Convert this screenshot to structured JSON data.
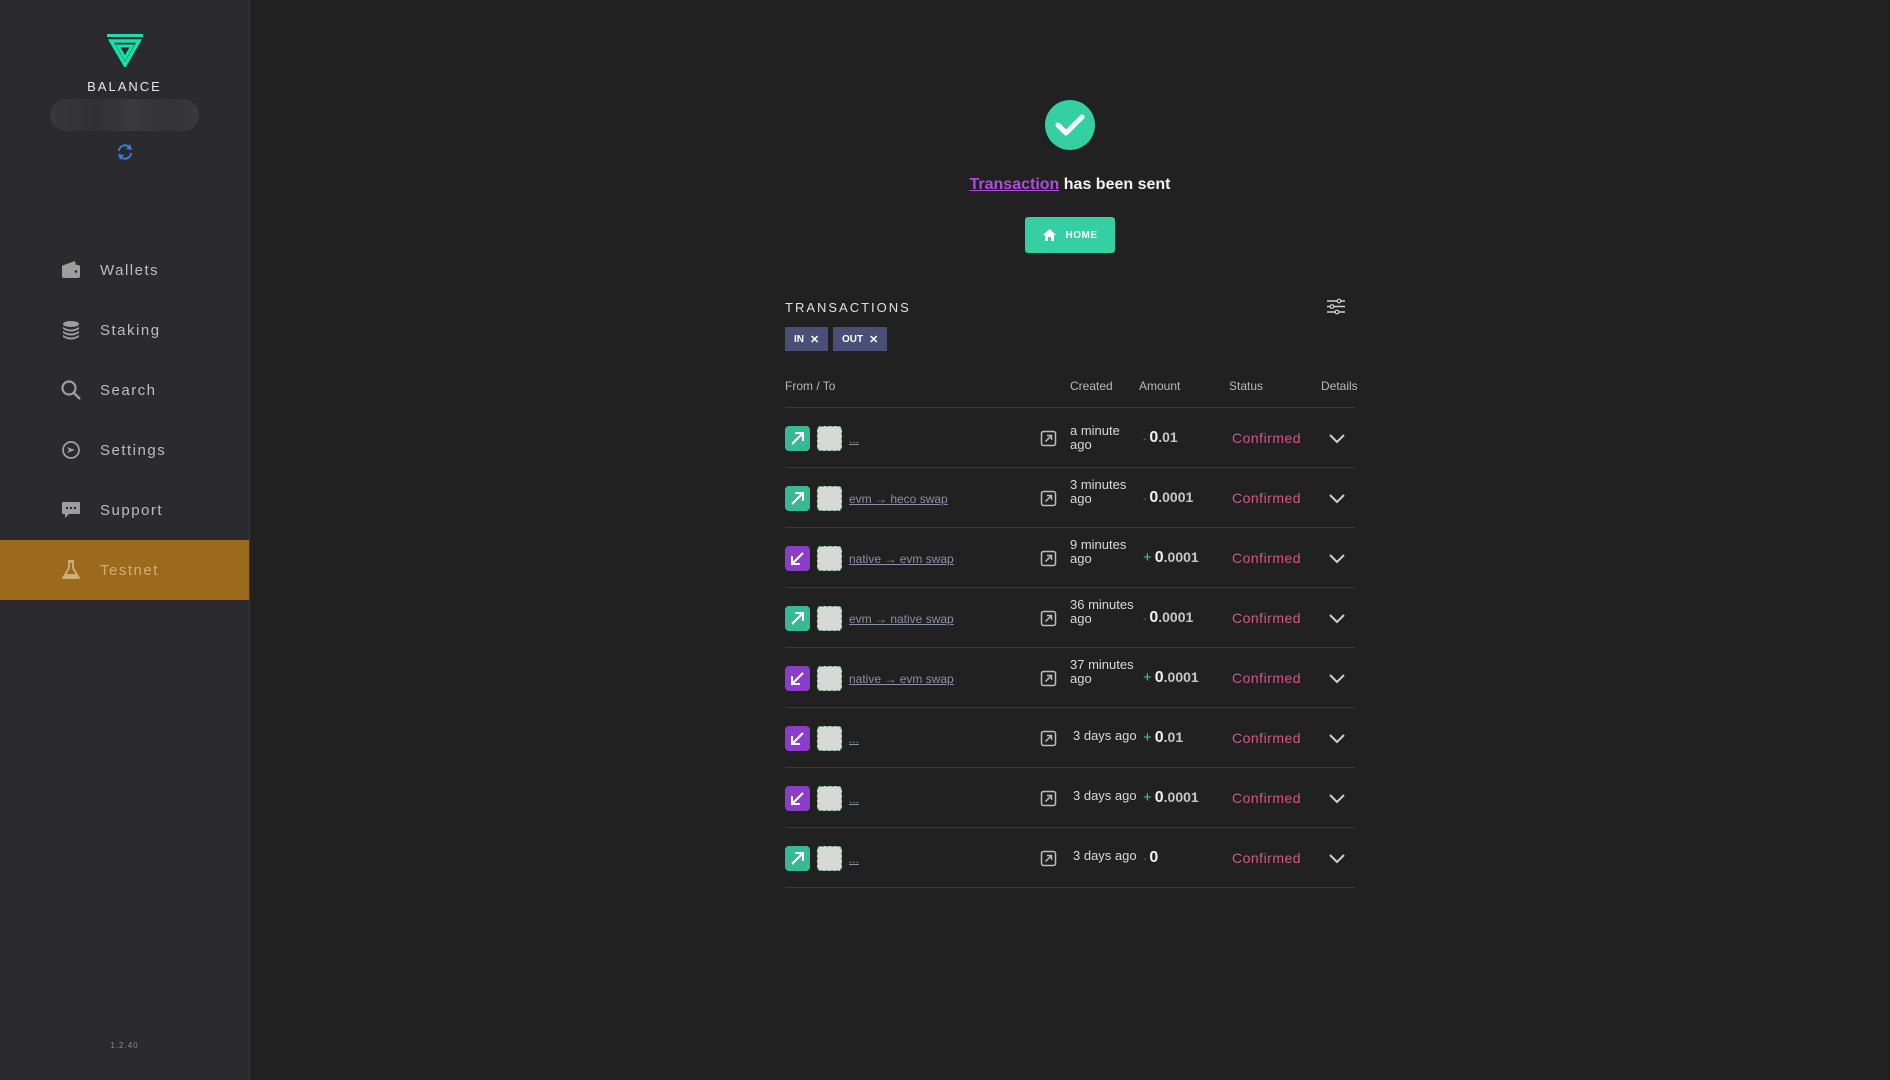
{
  "sidebar": {
    "balance_title": "BALANCE",
    "version": "1.2.40",
    "items": [
      {
        "label": "Wallets",
        "icon": "wallet-icon"
      },
      {
        "label": "Staking",
        "icon": "coins-stack-icon"
      },
      {
        "label": "Search",
        "icon": "search-icon"
      },
      {
        "label": "Settings",
        "icon": "settings-icon"
      },
      {
        "label": "Support",
        "icon": "chat-bubble-icon"
      },
      {
        "label": "Testnet",
        "icon": "flask-icon",
        "active": true
      }
    ]
  },
  "notice": {
    "link_text": "Transaction",
    "rest_text": " has been sent",
    "home_label": "HOME"
  },
  "transactions": {
    "title": "TRANSACTIONS",
    "filters": [
      "IN",
      "OUT"
    ],
    "headers": {
      "from_to": "From / To",
      "created": "Created",
      "amount": "Amount",
      "status": "Status",
      "details": "Details"
    },
    "rows": [
      {
        "dir": "out",
        "label": "...",
        "created": "a minute ago",
        "sign": "-",
        "int": "0",
        "frac": ".01",
        "status": "Confirmed"
      },
      {
        "dir": "out",
        "label": "evm → heco swap",
        "created": "3 minutes ago",
        "sign": "-",
        "int": "0",
        "frac": ".0001",
        "status": "Confirmed"
      },
      {
        "dir": "in",
        "label": "native → evm swap",
        "created": "9 minutes ago",
        "sign": "+",
        "int": "0",
        "frac": ".0001",
        "status": "Confirmed"
      },
      {
        "dir": "out",
        "label": "evm → native swap",
        "created": "36 minutes ago",
        "sign": "-",
        "int": "0",
        "frac": ".0001",
        "status": "Confirmed"
      },
      {
        "dir": "in",
        "label": "native → evm swap",
        "created": "37 minutes ago",
        "sign": "+",
        "int": "0",
        "frac": ".0001",
        "status": "Confirmed"
      },
      {
        "dir": "in",
        "label": "...",
        "created": "3 days ago",
        "sign": "+",
        "int": "0",
        "frac": ".01",
        "status": "Confirmed"
      },
      {
        "dir": "in",
        "label": "...",
        "created": "3 days ago",
        "sign": "+",
        "int": "0",
        "frac": ".0001",
        "status": "Confirmed"
      },
      {
        "dir": "out",
        "label": "...",
        "created": "3 days ago",
        "sign": "-",
        "int": "0",
        "frac": "",
        "status": "Confirmed"
      }
    ]
  },
  "colors": {
    "accent": "#34cfa3",
    "incoming": "#8b3ccb",
    "outgoing": "#38b894",
    "status": "#d2558b",
    "active_nav": "#9c6a1c"
  }
}
